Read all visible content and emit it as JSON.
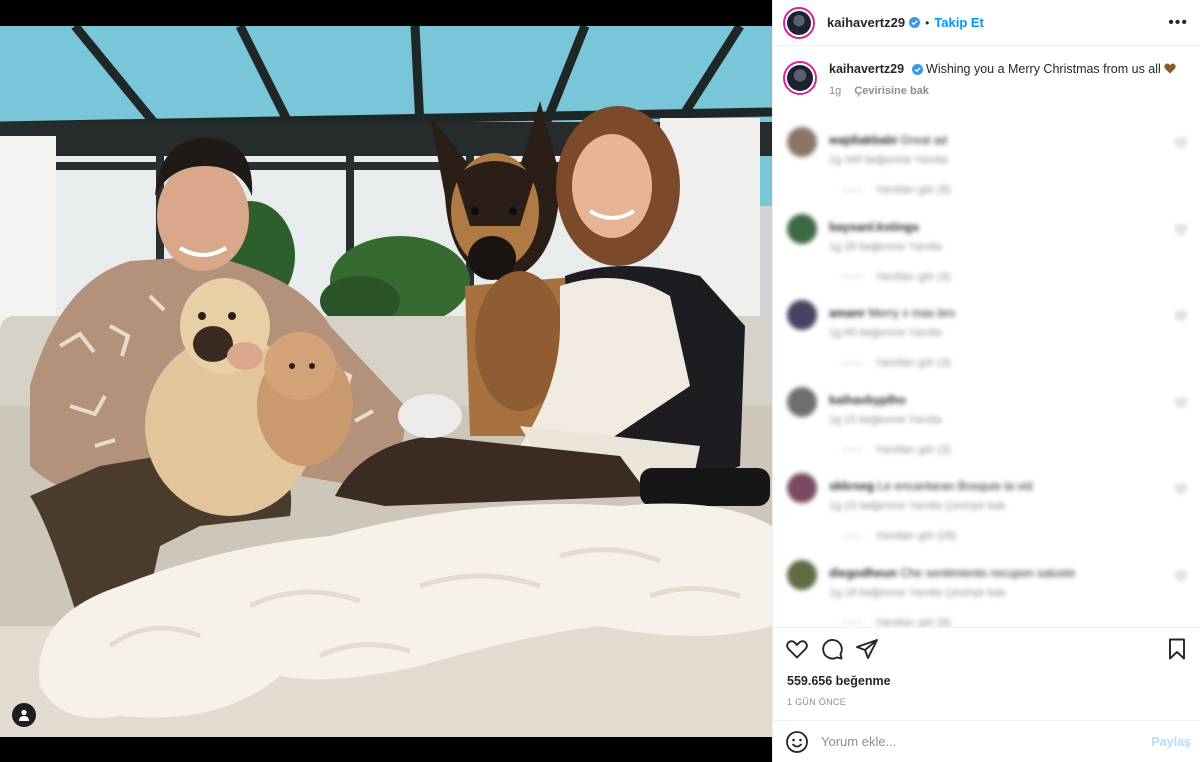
{
  "header": {
    "username": "kaihavertz29",
    "separator": "•",
    "follow_label": "Takip Et",
    "more_label": "•••"
  },
  "caption": {
    "username": "kaihavertz29",
    "text": "Wishing you a Merry Christmas from us all",
    "emoji": "brown-heart-icon",
    "time": "1g",
    "translate_label": "Çevirisine bak"
  },
  "comments": [
    {
      "username": "wajdiakbabi",
      "text": "Great ad",
      "meta": "1g  340 beğenme  Yanıtla",
      "replies": "Yanıtları gör (8)",
      "avatar_color": "#8a7566"
    },
    {
      "username": "baysanl.kstings",
      "text": "",
      "meta": "1g  28 beğenme  Yanıtla",
      "replies": "Yanıtları gör (4)",
      "avatar_color": "#3c6a42"
    },
    {
      "username": "amanr",
      "text": "Merry x mas bro",
      "meta": "1g  65 beğenme  Yanıtla",
      "replies": "Yanıtları gör (3)",
      "avatar_color": "#4a4260"
    },
    {
      "username": "kaihavbyplho",
      "text": "",
      "meta": "1g  15 beğenme  Yanıtla",
      "replies": "Yanıtları gör (3)",
      "avatar_color": "#6f6f6f"
    },
    {
      "username": "skkrseg",
      "text": "Le encantaran Bosquie la vid",
      "meta": "1g  23 beğenme  Yanıtla  Çeviriye bak",
      "replies": "Yanıtları gör (28)",
      "avatar_color": "#7a4a62"
    },
    {
      "username": "diegodheun",
      "text": "Che sentimiento recupon saluste",
      "meta": "1g  18 beğenme  Yanıtla  Çeviriye bak",
      "replies": "Yanıtları gör (9)",
      "avatar_color": "#5f6b43"
    }
  ],
  "actions": {
    "likes": "559.656 beğenme",
    "time_ago": "1 GÜN ÖNCE"
  },
  "composer": {
    "placeholder": "Yorum ekle...",
    "post_label": "Paylaş"
  },
  "colors": {
    "accent": "#0095f6",
    "verified": "#3897f0",
    "post_disabled": "#b2dffc"
  }
}
